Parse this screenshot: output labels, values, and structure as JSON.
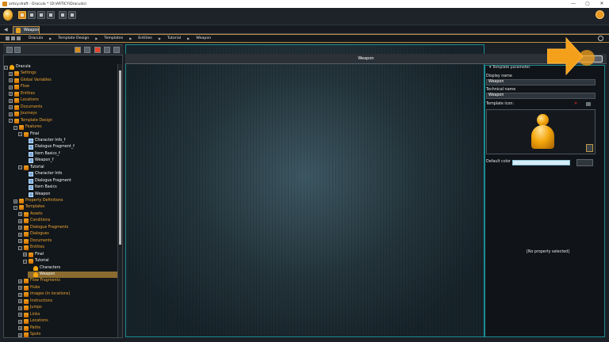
{
  "window": {
    "title": "articy:draft - Dracula * (D:\\ARTICY\\Dracula\\)",
    "controls": [
      "—",
      "▢",
      "✕"
    ]
  },
  "tabs": [
    {
      "label": "Weapon"
    }
  ],
  "breadcrumb": [
    "Dracula",
    "Template Design",
    "Templates",
    "Entities",
    "Tutorial",
    "Weapon"
  ],
  "center": {
    "title": "Weapon"
  },
  "properties": {
    "section_title": "Template parameter",
    "display_name_label": "Display name",
    "display_name_value": "Weapon",
    "technical_name_label": "Technical name",
    "technical_name_value": "Weapon",
    "template_icon_label": "Template icon:",
    "default_color_label": "Default color",
    "no_property": "[No property selected]"
  },
  "tree": [
    {
      "label": "Dracula",
      "color": "white",
      "level": 0,
      "icon": "pawn",
      "exp": "-"
    },
    {
      "label": "Settings",
      "color": "orange",
      "level": 1,
      "icon": "folder",
      "exp": "+"
    },
    {
      "label": "Global Variables",
      "color": "orange",
      "level": 1,
      "icon": "folder",
      "exp": "+"
    },
    {
      "label": "Flow",
      "color": "orange",
      "level": 1,
      "icon": "folder",
      "exp": "+"
    },
    {
      "label": "Entities",
      "color": "orange",
      "level": 1,
      "icon": "folder",
      "exp": "+"
    },
    {
      "label": "Locations",
      "color": "orange",
      "level": 1,
      "icon": "folder",
      "exp": "+"
    },
    {
      "label": "Documents",
      "color": "orange",
      "level": 1,
      "icon": "folder",
      "exp": "+"
    },
    {
      "label": "Journeys",
      "color": "orange",
      "level": 1,
      "icon": "folder",
      "exp": "+"
    },
    {
      "label": "Template Design",
      "color": "orange",
      "level": 1,
      "icon": "folder",
      "exp": "-"
    },
    {
      "label": "Features",
      "color": "orange",
      "level": 2,
      "icon": "folder",
      "exp": "-"
    },
    {
      "label": "Final",
      "color": "white",
      "level": 3,
      "icon": "folder",
      "exp": "-"
    },
    {
      "label": "Character Info_f",
      "color": "white",
      "level": 4,
      "icon": "book",
      "exp": ""
    },
    {
      "label": "Dialogue Fragment_f",
      "color": "white",
      "level": 4,
      "icon": "book",
      "exp": ""
    },
    {
      "label": "Item Basics_f",
      "color": "white",
      "level": 4,
      "icon": "book",
      "exp": ""
    },
    {
      "label": "Weapon_f",
      "color": "white",
      "level": 4,
      "icon": "book",
      "exp": ""
    },
    {
      "label": "Tutorial",
      "color": "white",
      "level": 3,
      "icon": "folder",
      "exp": "-"
    },
    {
      "label": "Character Info",
      "color": "white",
      "level": 4,
      "icon": "book",
      "exp": ""
    },
    {
      "label": "Dialogue Fragment",
      "color": "white",
      "level": 4,
      "icon": "book",
      "exp": ""
    },
    {
      "label": "Item Basics",
      "color": "white",
      "level": 4,
      "icon": "book",
      "exp": ""
    },
    {
      "label": "Weapon",
      "color": "white",
      "level": 4,
      "icon": "book",
      "exp": ""
    },
    {
      "label": "Property Definitions",
      "color": "orange",
      "level": 2,
      "icon": "folder",
      "exp": "+"
    },
    {
      "label": "Templates",
      "color": "orange",
      "level": 2,
      "icon": "folder",
      "exp": "-"
    },
    {
      "label": "Assets",
      "color": "orange",
      "level": 3,
      "icon": "folder",
      "exp": "+"
    },
    {
      "label": "Conditions",
      "color": "orange",
      "level": 3,
      "icon": "folder",
      "exp": "+"
    },
    {
      "label": "Dialogue Fragments",
      "color": "orange",
      "level": 3,
      "icon": "folder",
      "exp": "+"
    },
    {
      "label": "Dialogues",
      "color": "orange",
      "level": 3,
      "icon": "folder",
      "exp": "+"
    },
    {
      "label": "Documents",
      "color": "orange",
      "level": 3,
      "icon": "folder",
      "exp": "+"
    },
    {
      "label": "Entities",
      "color": "orange",
      "level": 3,
      "icon": "folder",
      "exp": "-"
    },
    {
      "label": "Final",
      "color": "white",
      "level": 4,
      "icon": "folder",
      "exp": "+"
    },
    {
      "label": "Tutorial",
      "color": "white",
      "level": 4,
      "icon": "folder",
      "exp": "-"
    },
    {
      "label": "Characters",
      "color": "white",
      "level": 5,
      "icon": "pawn",
      "exp": ""
    },
    {
      "label": "Weapon",
      "color": "white",
      "level": 5,
      "icon": "pawn",
      "exp": "",
      "selected": true
    },
    {
      "label": "Flow Fragments",
      "color": "orange",
      "level": 3,
      "icon": "folder",
      "exp": "+"
    },
    {
      "label": "Hubs",
      "color": "orange",
      "level": 3,
      "icon": "folder",
      "exp": "+"
    },
    {
      "label": "Images (in locations)",
      "color": "orange",
      "level": 3,
      "icon": "folder",
      "exp": "+"
    },
    {
      "label": "Instructions",
      "color": "orange",
      "level": 3,
      "icon": "folder",
      "exp": "+"
    },
    {
      "label": "Jumps",
      "color": "orange",
      "level": 3,
      "icon": "folder",
      "exp": "+"
    },
    {
      "label": "Links",
      "color": "orange",
      "level": 3,
      "icon": "folder",
      "exp": "+"
    },
    {
      "label": "Locations",
      "color": "orange",
      "level": 3,
      "icon": "folder",
      "exp": "+"
    },
    {
      "label": "Paths",
      "color": "orange",
      "level": 3,
      "icon": "folder",
      "exp": "+"
    },
    {
      "label": "Spots",
      "color": "orange",
      "level": 3,
      "icon": "folder",
      "exp": "+"
    }
  ],
  "accent": "#f4a01b",
  "teal": "#1a8d92"
}
